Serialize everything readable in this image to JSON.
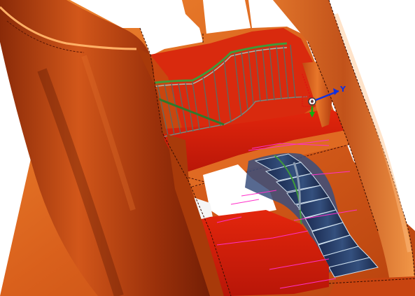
{
  "viewport": {
    "scene": "cad-3d-model",
    "background_color": "#ffffff",
    "colors": {
      "tower_wall_light": "#e8772a",
      "tower_wall_dark": "#7a2005",
      "floor_red": "#d51e0a",
      "floor_edge": "#a31407",
      "stair_tread": "#2a3e6b",
      "stair_tread_top": "#cfe0ee",
      "railing_post": "#6b7a70",
      "railing_top_green": "#3f9a3a",
      "pink_guides": "#ff2fc9",
      "triad_x_red": "#e01010",
      "triad_y_blue": "#1030e0",
      "triad_z_green": "#10b010"
    },
    "triad": {
      "icon": "coordinate-triad-icon",
      "y_label": "Y"
    }
  }
}
